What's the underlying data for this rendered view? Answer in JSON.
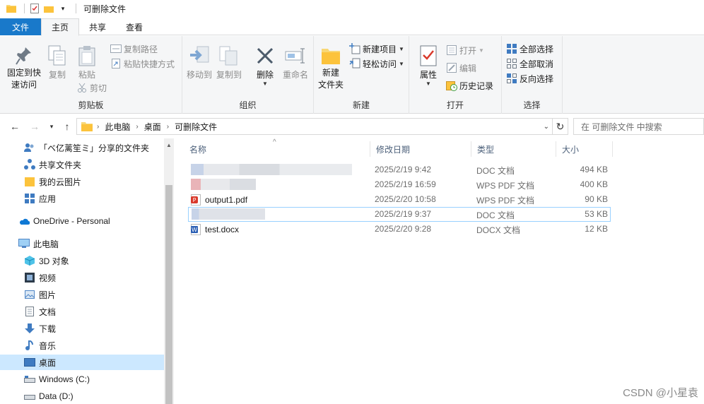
{
  "window": {
    "title": "可删除文件"
  },
  "tabs": [
    {
      "label": "文件"
    },
    {
      "label": "主页"
    },
    {
      "label": "共享"
    },
    {
      "label": "查看"
    }
  ],
  "ribbon": {
    "clipboard": {
      "label": "剪贴板",
      "pin": "固定到快\n速访问",
      "copy": "复制",
      "paste": "粘贴",
      "copy_path": "复制路径",
      "paste_shortcut": "粘贴快捷方式",
      "cut": "剪切"
    },
    "organize": {
      "label": "组织",
      "move_to": "移动到",
      "copy_to": "复制到",
      "delete": "删除",
      "rename": "重命名"
    },
    "new": {
      "label": "新建",
      "new_folder": "新建\n文件夹",
      "new_item": "新建项目",
      "easy_access": "轻松访问"
    },
    "open": {
      "label": "打开",
      "properties": "属性",
      "open": "打开",
      "edit": "编辑",
      "history": "历史记录"
    },
    "select": {
      "label": "选择",
      "select_all": "全部选择",
      "select_none": "全部取消",
      "invert": "反向选择"
    }
  },
  "address": {
    "segments": [
      "此电脑",
      "桌面",
      "可删除文件"
    ],
    "search_placeholder": "在 可删除文件 中搜索"
  },
  "nav": {
    "items": [
      {
        "label": "「ベ亿蓠笙ミ」分享的文件夹"
      },
      {
        "label": "共享文件夹"
      },
      {
        "label": "我的云图片"
      },
      {
        "label": "应用"
      },
      {
        "label": "OneDrive - Personal"
      },
      {
        "label": "此电脑"
      },
      {
        "label": "3D 对象"
      },
      {
        "label": "视频"
      },
      {
        "label": "图片"
      },
      {
        "label": "文档"
      },
      {
        "label": "下载"
      },
      {
        "label": "音乐"
      },
      {
        "label": "桌面"
      },
      {
        "label": "Windows (C:)"
      },
      {
        "label": "Data (D:)"
      }
    ]
  },
  "columns": {
    "name": "名称",
    "date": "修改日期",
    "type": "类型",
    "size": "大小"
  },
  "files": [
    {
      "name": "",
      "date": "2025/2/19 9:42",
      "type": "DOC 文档",
      "size": "494 KB"
    },
    {
      "name": "",
      "date": "2025/2/19 16:59",
      "type": "WPS PDF 文档",
      "size": "400 KB"
    },
    {
      "name": "output1.pdf",
      "date": "2025/2/20 10:58",
      "type": "WPS PDF 文档",
      "size": "90 KB"
    },
    {
      "name": "",
      "date": "2025/2/19 9:37",
      "type": "DOC 文档",
      "size": "53 KB"
    },
    {
      "name": "test.docx",
      "date": "2025/2/20 9:28",
      "type": "DOCX 文档",
      "size": "12 KB"
    }
  ],
  "watermark": "CSDN @小星袁",
  "colors": {
    "accent": "#1979ca",
    "selected": "#cce8ff",
    "hover_border": "#99d1ff"
  }
}
